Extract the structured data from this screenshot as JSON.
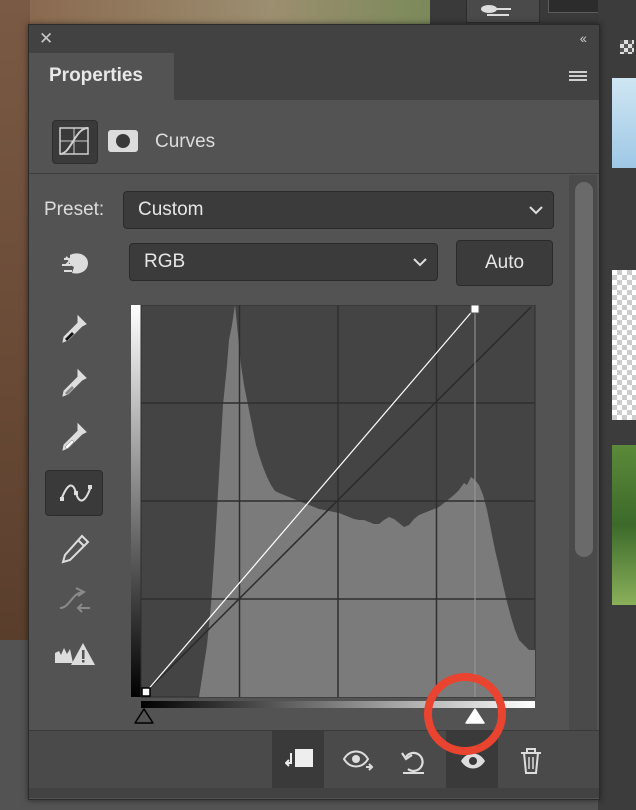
{
  "panel": {
    "tab_label": "Properties",
    "adjustment_title": "Curves",
    "preset_label": "Preset:",
    "preset_value": "Custom",
    "channel_value": "RGB",
    "auto_label": "Auto"
  },
  "tools": [
    {
      "icon": "on-image-adjustment-hand-icon"
    },
    {
      "icon": "black-point-eyedropper-icon"
    },
    {
      "icon": "gray-point-eyedropper-icon"
    },
    {
      "icon": "white-point-eyedropper-icon"
    },
    {
      "icon": "edit-points-curve-icon",
      "active": true
    },
    {
      "icon": "pencil-draw-icon"
    },
    {
      "icon": "smooth-curve-icon"
    },
    {
      "icon": "clipping-warning-icon"
    }
  ],
  "curve": {
    "input_range": [
      0,
      255
    ],
    "output_range": [
      0,
      255
    ],
    "points": [
      [
        0,
        0
      ],
      [
        213,
        255
      ]
    ]
  },
  "bottom_buttons": [
    {
      "icon": "clip-to-layer-icon"
    },
    {
      "icon": "view-previous-state-icon"
    },
    {
      "icon": "reset-adjustment-icon"
    },
    {
      "icon": "toggle-visibility-icon",
      "active": true
    },
    {
      "icon": "delete-adjustment-icon"
    }
  ],
  "colors": {
    "panel_bg": "#535353",
    "highlight_ring": "#e8442f"
  }
}
